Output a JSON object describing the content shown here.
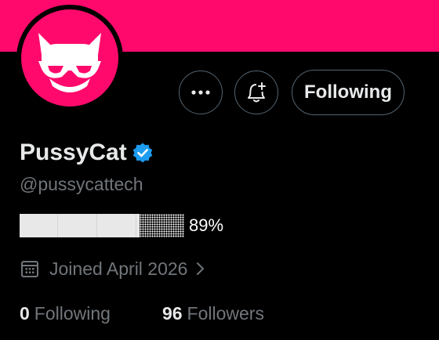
{
  "profile": {
    "display_name": "PussyCat",
    "handle": "@pussycattech",
    "verified": true,
    "joined": "Joined April 2026",
    "following_count": "0",
    "following_label": "Following",
    "followers_count": "96",
    "followers_label": "Followers"
  },
  "actions": {
    "more_icon": "more-horizontal-icon",
    "notify_icon": "bell-plus-icon",
    "follow_label": "Following"
  },
  "progress": {
    "value": 0.89,
    "label": "89%"
  },
  "colors": {
    "banner": "#ff0a6c",
    "avatar_bg": "#ff0a6c",
    "verified": "#1d9bf0",
    "muted_text": "#71767b",
    "primary_text": "#e7e9ea"
  },
  "icons": {
    "avatar": "cat-with-sunglasses-logo",
    "verified": "verified-badge-icon",
    "calendar": "calendar-icon",
    "chevron": "chevron-right-icon"
  }
}
